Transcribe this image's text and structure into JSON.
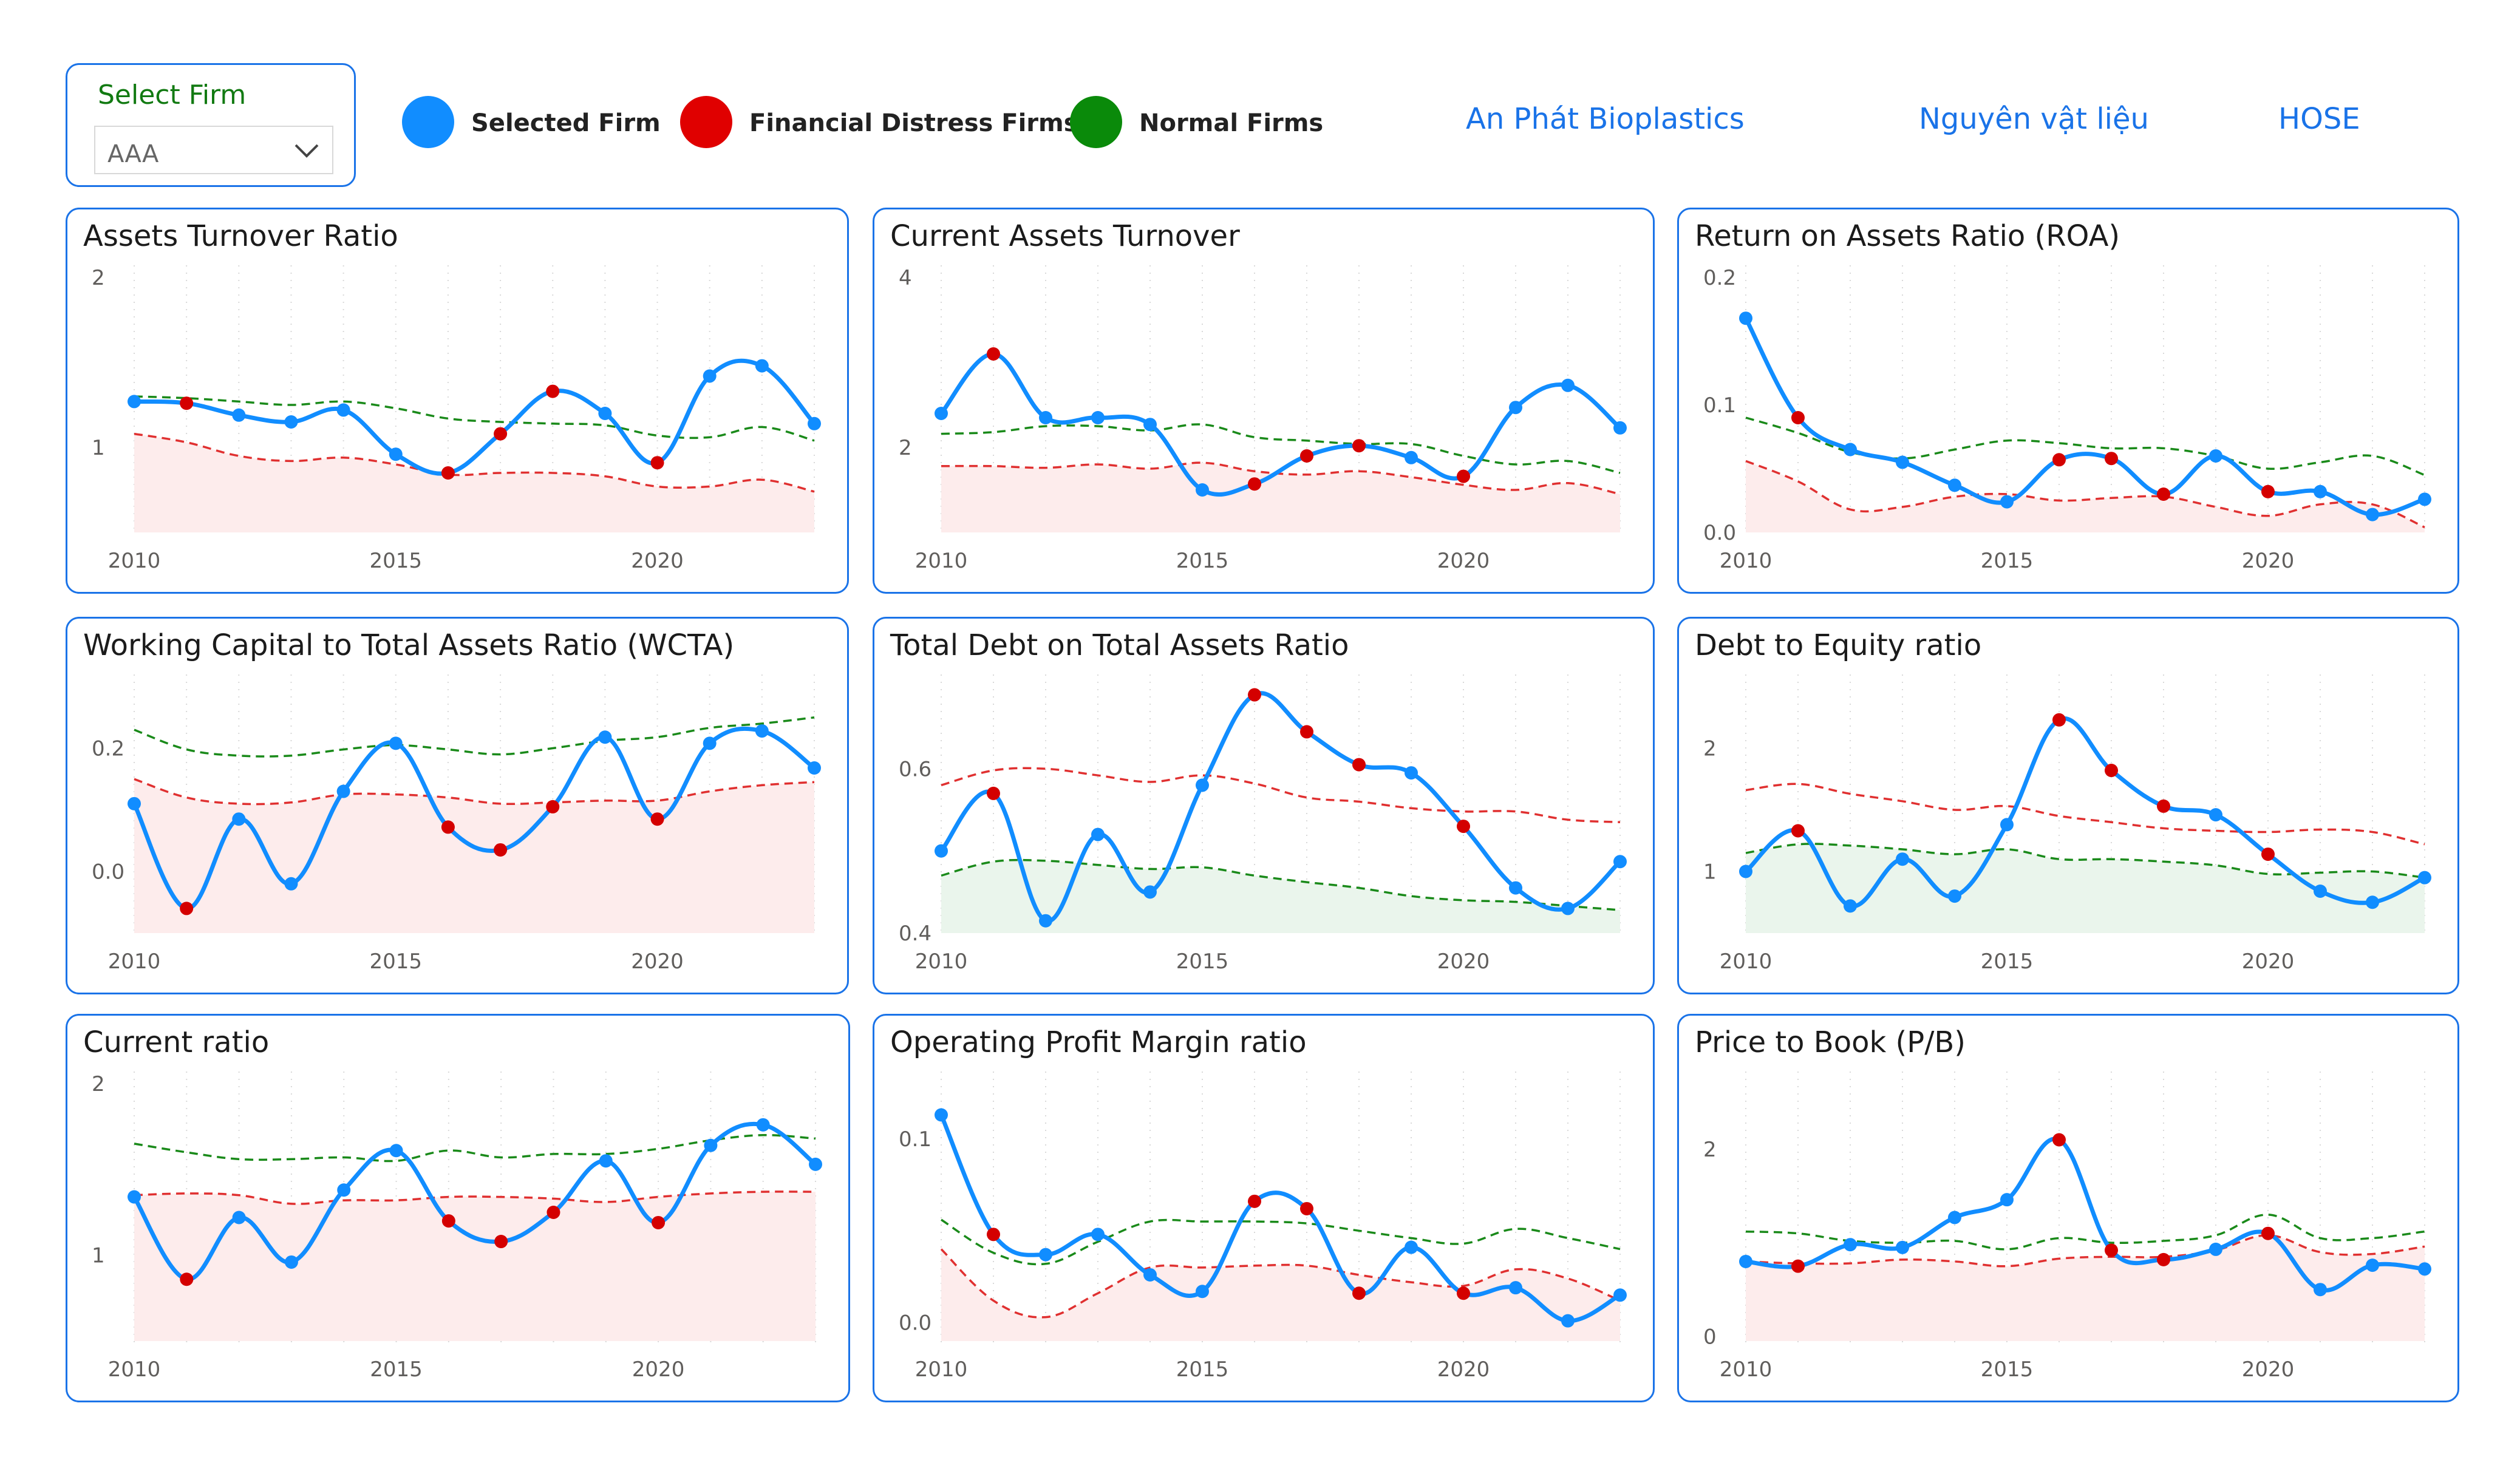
{
  "slicer": {
    "title": "Select Firm",
    "value": "AAA"
  },
  "legend": [
    {
      "label": "Selected Firm",
      "color": "#118dff"
    },
    {
      "label": "Financial Distress Firms",
      "color": "#e00000"
    },
    {
      "label": "Normal Firms",
      "color": "#0a8a0a"
    }
  ],
  "info": {
    "company": "An Phát Bioplastics",
    "industry": "Nguyên vật liệu",
    "exchange": "HOSE"
  },
  "colors": {
    "selected": "#118dff",
    "distress_point": "#d40000",
    "distress_line": "#e03030",
    "normal_line": "#1a8a1a",
    "distress_fill": "#fdecec",
    "normal_fill": "#eaf5ec",
    "panel_border": "#1a73e8"
  },
  "chart_data": [
    {
      "type": "line",
      "title": "Assets Turnover Ratio",
      "x": [
        2010,
        2011,
        2012,
        2013,
        2014,
        2015,
        2016,
        2017,
        2018,
        2019,
        2020,
        2021,
        2022,
        2023
      ],
      "xticks": [
        2010,
        2015,
        2020
      ],
      "ylim": [
        0.5,
        2.0
      ],
      "yticks": [
        1,
        2
      ],
      "ytick_labels": [
        "1",
        "2"
      ],
      "area": "distress",
      "series": [
        {
          "name": "Selected Firm",
          "role": "selected",
          "values": [
            1.27,
            1.26,
            1.19,
            1.15,
            1.22,
            0.96,
            0.85,
            1.08,
            1.33,
            1.2,
            0.91,
            1.42,
            1.48,
            1.14
          ],
          "distress_years": [
            2011,
            2016,
            2017,
            2018,
            2020
          ]
        },
        {
          "name": "Financial Distress Firms",
          "role": "distress",
          "values": [
            1.08,
            1.03,
            0.95,
            0.92,
            0.94,
            0.9,
            0.84,
            0.85,
            0.85,
            0.83,
            0.77,
            0.77,
            0.81,
            0.74
          ]
        },
        {
          "name": "Normal Firms",
          "role": "normal",
          "values": [
            1.3,
            1.29,
            1.27,
            1.25,
            1.27,
            1.23,
            1.17,
            1.15,
            1.14,
            1.13,
            1.07,
            1.06,
            1.12,
            1.04
          ]
        }
      ]
    },
    {
      "type": "line",
      "title": "Current Assets Turnover",
      "x": [
        2010,
        2011,
        2012,
        2013,
        2014,
        2015,
        2016,
        2017,
        2018,
        2019,
        2020,
        2021,
        2022,
        2023
      ],
      "xticks": [
        2010,
        2015,
        2020
      ],
      "ylim": [
        1.0,
        4.0
      ],
      "yticks": [
        2,
        4
      ],
      "ytick_labels": [
        "2",
        "4"
      ],
      "area": "distress",
      "series": [
        {
          "name": "Selected Firm",
          "role": "selected",
          "values": [
            2.4,
            3.1,
            2.35,
            2.35,
            2.27,
            1.5,
            1.57,
            1.9,
            2.02,
            1.88,
            1.66,
            2.47,
            2.73,
            2.23
          ],
          "distress_years": [
            2011,
            2016,
            2017,
            2018,
            2020
          ]
        },
        {
          "name": "Financial Distress Firms",
          "role": "distress",
          "values": [
            1.78,
            1.78,
            1.76,
            1.8,
            1.75,
            1.82,
            1.72,
            1.68,
            1.72,
            1.65,
            1.56,
            1.5,
            1.58,
            1.45
          ]
        },
        {
          "name": "Normal Firms",
          "role": "normal",
          "values": [
            2.16,
            2.18,
            2.25,
            2.25,
            2.2,
            2.27,
            2.12,
            2.08,
            2.04,
            2.04,
            1.9,
            1.8,
            1.84,
            1.7
          ]
        }
      ]
    },
    {
      "type": "line",
      "title": "Return on Assets Ratio (ROA)",
      "x": [
        2010,
        2011,
        2012,
        2013,
        2014,
        2015,
        2016,
        2017,
        2018,
        2019,
        2020,
        2021,
        2022,
        2023
      ],
      "xticks": [
        2010,
        2015,
        2020
      ],
      "ylim": [
        0.0,
        0.2
      ],
      "yticks": [
        0.0,
        0.1,
        0.2
      ],
      "ytick_labels": [
        "0.0",
        "0.1",
        "0.2"
      ],
      "area": "distress",
      "series": [
        {
          "name": "Selected Firm",
          "role": "selected",
          "values": [
            0.168,
            0.09,
            0.065,
            0.055,
            0.037,
            0.024,
            0.057,
            0.058,
            0.03,
            0.06,
            0.032,
            0.032,
            0.014,
            0.026
          ],
          "distress_years": [
            2011,
            2016,
            2017,
            2018,
            2020
          ]
        },
        {
          "name": "Financial Distress Firms",
          "role": "distress",
          "values": [
            0.056,
            0.04,
            0.018,
            0.02,
            0.028,
            0.03,
            0.025,
            0.027,
            0.028,
            0.02,
            0.013,
            0.022,
            0.022,
            0.004
          ]
        },
        {
          "name": "Normal Firms",
          "role": "normal",
          "values": [
            0.09,
            0.078,
            0.063,
            0.058,
            0.065,
            0.072,
            0.07,
            0.066,
            0.066,
            0.06,
            0.05,
            0.055,
            0.06,
            0.045
          ]
        }
      ]
    },
    {
      "type": "line",
      "title": "Working Capital to Total Assets Ratio (WCTA)",
      "x": [
        2010,
        2011,
        2012,
        2013,
        2014,
        2015,
        2016,
        2017,
        2018,
        2019,
        2020,
        2021,
        2022,
        2023
      ],
      "xticks": [
        2010,
        2015,
        2020
      ],
      "ylim": [
        -0.1,
        0.3
      ],
      "yticks": [
        0.0,
        0.2
      ],
      "ytick_labels": [
        "0.0",
        "0.2"
      ],
      "area": "distress",
      "series": [
        {
          "name": "Selected Firm",
          "role": "selected",
          "values": [
            0.11,
            -0.06,
            0.085,
            -0.02,
            0.13,
            0.208,
            0.072,
            0.035,
            0.105,
            0.218,
            0.085,
            0.208,
            0.228,
            0.168
          ],
          "distress_years": [
            2011,
            2016,
            2017,
            2018,
            2020
          ]
        },
        {
          "name": "Financial Distress Firms",
          "role": "distress",
          "values": [
            0.15,
            0.12,
            0.11,
            0.112,
            0.125,
            0.125,
            0.12,
            0.11,
            0.112,
            0.115,
            0.115,
            0.13,
            0.14,
            0.145
          ]
        },
        {
          "name": "Normal Firms",
          "role": "normal",
          "values": [
            0.23,
            0.198,
            0.188,
            0.188,
            0.198,
            0.205,
            0.198,
            0.19,
            0.2,
            0.212,
            0.218,
            0.233,
            0.24,
            0.25
          ]
        }
      ]
    },
    {
      "type": "line",
      "title": "Total Debt on Total Assets Ratio",
      "x": [
        2010,
        2011,
        2012,
        2013,
        2014,
        2015,
        2016,
        2017,
        2018,
        2019,
        2020,
        2021,
        2022,
        2023
      ],
      "xticks": [
        2010,
        2015,
        2020
      ],
      "ylim": [
        0.4,
        0.7
      ],
      "yticks": [
        0.4,
        0.6
      ],
      "ytick_labels": [
        "0.4",
        "0.6"
      ],
      "area": "normal",
      "series": [
        {
          "name": "Selected Firm",
          "role": "selected",
          "values": [
            0.5,
            0.57,
            0.415,
            0.52,
            0.45,
            0.58,
            0.69,
            0.645,
            0.605,
            0.595,
            0.53,
            0.455,
            0.43,
            0.487
          ],
          "distress_years": [
            2011,
            2016,
            2017,
            2018,
            2020
          ]
        },
        {
          "name": "Financial Distress Firms",
          "role": "distress",
          "values": [
            0.58,
            0.598,
            0.6,
            0.592,
            0.584,
            0.592,
            0.582,
            0.565,
            0.56,
            0.552,
            0.548,
            0.548,
            0.538,
            0.535
          ]
        },
        {
          "name": "Normal Firms",
          "role": "normal",
          "values": [
            0.47,
            0.487,
            0.488,
            0.483,
            0.478,
            0.48,
            0.47,
            0.462,
            0.455,
            0.445,
            0.44,
            0.438,
            0.433,
            0.428
          ]
        }
      ]
    },
    {
      "type": "line",
      "title": "Debt to Equity ratio",
      "x": [
        2010,
        2011,
        2012,
        2013,
        2014,
        2015,
        2016,
        2017,
        2018,
        2019,
        2020,
        2021,
        2022,
        2023
      ],
      "xticks": [
        2010,
        2015,
        2020
      ],
      "ylim": [
        0.5,
        2.5
      ],
      "yticks": [
        1,
        2
      ],
      "ytick_labels": [
        "1",
        "2"
      ],
      "area": "normal",
      "series": [
        {
          "name": "Selected Firm",
          "role": "selected",
          "values": [
            1.0,
            1.33,
            0.72,
            1.1,
            0.8,
            1.38,
            2.23,
            1.82,
            1.53,
            1.46,
            1.14,
            0.84,
            0.75,
            0.95
          ],
          "distress_years": [
            2011,
            2016,
            2017,
            2018,
            2020
          ]
        },
        {
          "name": "Financial Distress Firms",
          "role": "distress",
          "values": [
            1.66,
            1.71,
            1.63,
            1.57,
            1.5,
            1.53,
            1.45,
            1.4,
            1.35,
            1.33,
            1.32,
            1.34,
            1.32,
            1.22
          ]
        },
        {
          "name": "Normal Firms",
          "role": "normal",
          "values": [
            1.15,
            1.22,
            1.21,
            1.18,
            1.14,
            1.18,
            1.1,
            1.1,
            1.08,
            1.05,
            0.98,
            0.99,
            1.0,
            0.95
          ]
        }
      ]
    },
    {
      "type": "line",
      "title": "Current ratio",
      "x": [
        2010,
        2011,
        2012,
        2013,
        2014,
        2015,
        2016,
        2017,
        2018,
        2019,
        2020,
        2021,
        2022,
        2023
      ],
      "xticks": [
        2010,
        2015,
        2020
      ],
      "ylim": [
        0.5,
        2.0
      ],
      "yticks": [
        1,
        2
      ],
      "ytick_labels": [
        "1",
        "2"
      ],
      "area": "distress",
      "series": [
        {
          "name": "Selected Firm",
          "role": "selected",
          "values": [
            1.34,
            0.86,
            1.22,
            0.96,
            1.38,
            1.61,
            1.2,
            1.08,
            1.25,
            1.55,
            1.19,
            1.64,
            1.76,
            1.53
          ],
          "distress_years": [
            2011,
            2016,
            2017,
            2018,
            2020
          ]
        },
        {
          "name": "Financial Distress Firms",
          "role": "distress",
          "values": [
            1.35,
            1.36,
            1.35,
            1.3,
            1.32,
            1.32,
            1.34,
            1.34,
            1.33,
            1.31,
            1.34,
            1.36,
            1.37,
            1.37
          ]
        },
        {
          "name": "Normal Firms",
          "role": "normal",
          "values": [
            1.65,
            1.6,
            1.56,
            1.56,
            1.57,
            1.55,
            1.61,
            1.57,
            1.59,
            1.59,
            1.62,
            1.67,
            1.7,
            1.68
          ]
        }
      ]
    },
    {
      "type": "line",
      "title": "Operating Profit Margin ratio",
      "x": [
        2010,
        2011,
        2012,
        2013,
        2014,
        2015,
        2016,
        2017,
        2018,
        2019,
        2020,
        2021,
        2022,
        2023
      ],
      "xticks": [
        2010,
        2015,
        2020
      ],
      "ylim": [
        -0.01,
        0.13
      ],
      "yticks": [
        0.0,
        0.1
      ],
      "ytick_labels": [
        "0.0",
        "0.1"
      ],
      "area": "distress",
      "series": [
        {
          "name": "Selected Firm",
          "role": "selected",
          "values": [
            0.113,
            0.048,
            0.037,
            0.048,
            0.026,
            0.017,
            0.066,
            0.062,
            0.016,
            0.041,
            0.016,
            0.019,
            0.001,
            0.015
          ],
          "distress_years": [
            2011,
            2016,
            2017,
            2018,
            2020
          ]
        },
        {
          "name": "Financial Distress Firms",
          "role": "distress",
          "values": [
            0.04,
            0.012,
            0.003,
            0.016,
            0.03,
            0.03,
            0.031,
            0.031,
            0.026,
            0.022,
            0.02,
            0.029,
            0.024,
            0.012
          ]
        },
        {
          "name": "Normal Firms",
          "role": "normal",
          "values": [
            0.056,
            0.038,
            0.032,
            0.044,
            0.055,
            0.055,
            0.055,
            0.054,
            0.05,
            0.046,
            0.043,
            0.051,
            0.046,
            0.04
          ]
        }
      ]
    },
    {
      "type": "line",
      "title": "Price to Book (P/B)",
      "x": [
        2010,
        2011,
        2012,
        2013,
        2014,
        2015,
        2016,
        2017,
        2018,
        2019,
        2020,
        2021,
        2022,
        2023
      ],
      "xticks": [
        2010,
        2015,
        2020
      ],
      "ylim": [
        -0.05,
        2.7
      ],
      "yticks": [
        0,
        2
      ],
      "ytick_labels": [
        "0",
        "2"
      ],
      "area": "distress",
      "series": [
        {
          "name": "Selected Firm",
          "role": "selected",
          "values": [
            0.8,
            0.75,
            0.98,
            0.95,
            1.27,
            1.46,
            2.1,
            0.92,
            0.82,
            0.93,
            1.1,
            0.5,
            0.76,
            0.72
          ],
          "distress_years": [
            2011,
            2016,
            2017,
            2018,
            2020
          ]
        },
        {
          "name": "Financial Distress Firms",
          "role": "distress",
          "values": [
            0.8,
            0.78,
            0.78,
            0.82,
            0.8,
            0.75,
            0.83,
            0.85,
            0.85,
            0.92,
            1.08,
            0.9,
            0.88,
            0.96
          ]
        },
        {
          "name": "Normal Firms",
          "role": "normal",
          "values": [
            1.12,
            1.1,
            1.02,
            1.0,
            1.02,
            0.93,
            1.05,
            1.0,
            1.02,
            1.08,
            1.3,
            1.05,
            1.05,
            1.12
          ]
        }
      ]
    }
  ]
}
